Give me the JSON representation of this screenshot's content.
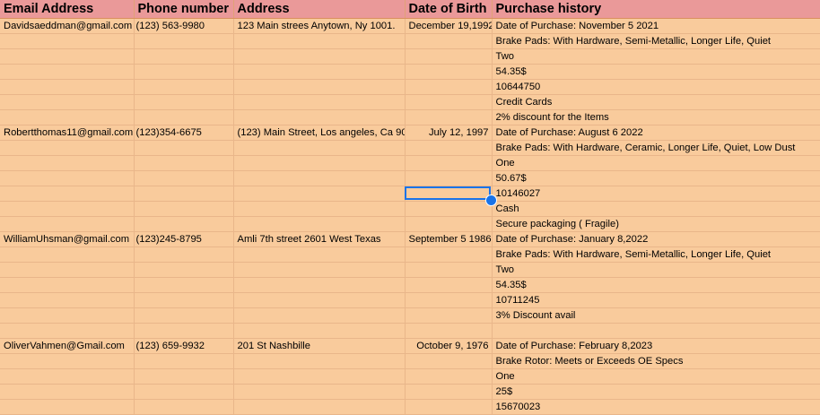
{
  "headers": [
    "Email Address",
    "Phone number",
    "Address",
    "Date of Birth",
    "Purchase history"
  ],
  "rows": [
    [
      "Davidsaeddman@gmail.com",
      "(123) 563-9980",
      "123 Main strees Anytown, Ny 1001.",
      "December 19,1992",
      " Date of Purchase: November 5 2021"
    ],
    [
      "",
      "",
      "",
      "",
      "Brake Pads: With Hardware, Semi-Metallic, Longer Life, Quiet"
    ],
    [
      "",
      "",
      "",
      "",
      "Two"
    ],
    [
      "",
      "",
      "",
      "",
      "54.35$"
    ],
    [
      "",
      "",
      "",
      "",
      "10644750"
    ],
    [
      "",
      "",
      "",
      "",
      "Credit Cards"
    ],
    [
      "",
      "",
      "",
      "",
      "2% discount for the Items"
    ],
    [
      "Robertthomas11@gmail.com",
      "(123)354-6675",
      "(123) Main Street, Los angeles, Ca 90",
      "July 12, 1997",
      "Date of Purchase: August 6 2022"
    ],
    [
      "",
      "",
      "",
      "",
      "Brake Pads: With Hardware, Ceramic, Longer Life, Quiet, Low Dust"
    ],
    [
      "",
      "",
      "",
      "",
      "One"
    ],
    [
      "",
      "",
      "",
      "",
      "50.67$"
    ],
    [
      "",
      "",
      "",
      "",
      "10146027"
    ],
    [
      "",
      "",
      "",
      "",
      "Cash"
    ],
    [
      "",
      "",
      "",
      "",
      "Secure packaging ( Fragile)"
    ],
    [
      "WilliamUhsman@gmail.com",
      "(123)245-8795",
      "Amli 7th street 2601 West Texas",
      "September 5 1986",
      "Date of Purchase: January 8,2022"
    ],
    [
      "",
      "",
      "",
      "",
      "Brake Pads: With Hardware, Semi-Metallic, Longer Life, Quiet"
    ],
    [
      "",
      "",
      "",
      "",
      "Two"
    ],
    [
      "",
      "",
      "",
      "",
      "54.35$"
    ],
    [
      "",
      "",
      "",
      "",
      "10711245"
    ],
    [
      "",
      "",
      "",
      "",
      "3% Discount avail"
    ],
    [
      "",
      "",
      "",
      "",
      ""
    ],
    [
      "OliverVahmen@Gmail.com",
      "(123) 659-9932",
      "201 St Nashbille",
      "October 9, 1976",
      "Date of Purchase: February 8,2023"
    ],
    [
      "",
      "",
      "",
      "",
      "Brake Rotor: Meets or Exceeds OE Specs"
    ],
    [
      "",
      "",
      "",
      "",
      "One"
    ],
    [
      "",
      "",
      "",
      "",
      "25$"
    ],
    [
      "",
      "",
      "",
      "",
      "15670023"
    ]
  ]
}
